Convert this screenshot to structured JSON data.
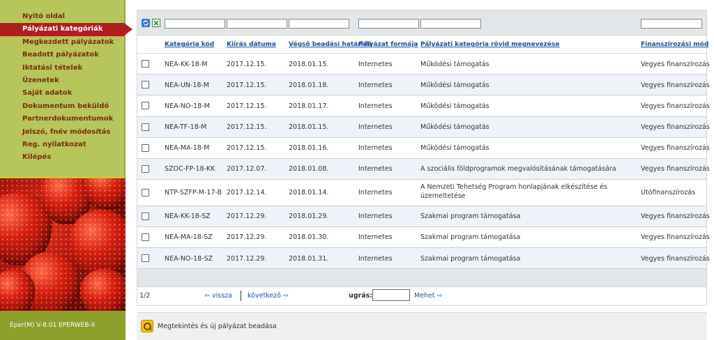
{
  "sidebar": {
    "items": [
      {
        "label": "Nyitó oldal",
        "active": false
      },
      {
        "label": "Pályázati kategóriák",
        "active": true
      },
      {
        "label": "Megkezdett pályázatok",
        "active": false
      },
      {
        "label": "Beadott pályázatok",
        "active": false
      },
      {
        "label": "Iktatási tételek",
        "active": false
      },
      {
        "label": "Üzenetek",
        "active": false
      },
      {
        "label": "Saját adatok",
        "active": false
      },
      {
        "label": "Dokumentum beküldő",
        "active": false
      },
      {
        "label": "Partnerdokumentumok",
        "active": false
      },
      {
        "label": "Jelszó, fnév módosítás",
        "active": false
      },
      {
        "label": "Reg. nyilatkozat",
        "active": false
      },
      {
        "label": "Kilépés",
        "active": false
      }
    ],
    "version": "Eper(M) V-8.01 EPERWEB-II"
  },
  "table": {
    "headers": {
      "code": "Kategória kód",
      "issue_date": "Kiírás dátuma",
      "deadline": "Végső beadási határidő",
      "form": "Pályázat formája",
      "name": "Pályázati kategória rövid megnevezése",
      "financing": "Finanszírozási mód"
    },
    "rows": [
      {
        "code": "NEA-KK-18-M",
        "issue_date": "2017.12.15.",
        "deadline": "2018.01.15.",
        "form": "Internetes",
        "name": "Működési támogatás",
        "financing": "Vegyes finanszírozás"
      },
      {
        "code": "NEA-UN-18-M",
        "issue_date": "2017.12.15.",
        "deadline": "2018.01.18.",
        "form": "Internetes",
        "name": "Működési támogatás",
        "financing": "Vegyes finanszírozás"
      },
      {
        "code": "NEA-NO-18-M",
        "issue_date": "2017.12.15.",
        "deadline": "2018.01.17.",
        "form": "Internetes",
        "name": "Működési támogatás",
        "financing": "Vegyes finanszírozás"
      },
      {
        "code": "NEA-TF-18-M",
        "issue_date": "2017.12.15.",
        "deadline": "2018.01.15.",
        "form": "Internetes",
        "name": "Működési támogatás",
        "financing": "Vegyes finanszírozás"
      },
      {
        "code": "NEA-MA-18-M",
        "issue_date": "2017.12.15.",
        "deadline": "2018.01.16.",
        "form": "Internetes",
        "name": "Működési támogatás",
        "financing": "Vegyes finanszírozás"
      },
      {
        "code": "SZOC-FP-18-KK",
        "issue_date": "2017.12.07.",
        "deadline": "2018.01.08.",
        "form": "Internetes",
        "name": "A szociális földprogramok megvalósításának támogatására",
        "financing": "Vegyes finanszírozás"
      },
      {
        "code": "NTP-SZFP-M-17-B",
        "issue_date": "2017.12.14.",
        "deadline": "2018.01.14.",
        "form": "Internetes",
        "name": "A Nemzeti Tehetség Program honlapjának elkészítése és üzemeltetése",
        "financing": "Utófinanszírozás"
      },
      {
        "code": "NEA-KK-18-SZ",
        "issue_date": "2017.12.29.",
        "deadline": "2018.01.29.",
        "form": "Internetes",
        "name": "Szakmai program támogatása",
        "financing": "Vegyes finanszírozás"
      },
      {
        "code": "NEA-MA-18-SZ",
        "issue_date": "2017.12.29.",
        "deadline": "2018.01.30.",
        "form": "Internetes",
        "name": "Szakmai program támogatása",
        "financing": "Vegyes finanszírozás"
      },
      {
        "code": "NEA-NO-18-SZ",
        "issue_date": "2017.12.29.",
        "deadline": "2018.01.31.",
        "form": "Internetes",
        "name": "Szakmai program támogatása",
        "financing": "Vegyes finanszírozás"
      }
    ]
  },
  "pager": {
    "page_info": "1/2",
    "prev_label": "vissza",
    "next_label": "következő",
    "jump_label": "ugrás:",
    "go_label": "Mehet"
  },
  "bottom": {
    "action_label": "Megtekintés és új pályázat beadása"
  },
  "colors": {
    "sidebar_green": "#b6c65a",
    "active_red": "#b01e1e",
    "menu_text": "#7a2e0c",
    "link_blue": "#1a4f9e"
  }
}
